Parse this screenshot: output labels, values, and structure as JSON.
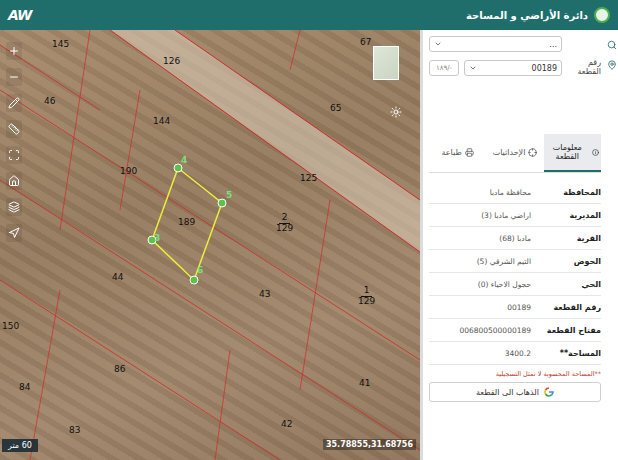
{
  "header": {
    "logo": "AW",
    "title": "دائرة الأراضي و المساحة"
  },
  "map": {
    "parcels": [
      {
        "label": "145"
      },
      {
        "label": "126"
      },
      {
        "label": "67"
      },
      {
        "label": "46"
      },
      {
        "label": "144"
      },
      {
        "label": "65"
      },
      {
        "label": "190"
      },
      {
        "label": "125"
      },
      {
        "label": "44"
      },
      {
        "label": "43"
      },
      {
        "label": "150"
      },
      {
        "label": "86"
      },
      {
        "label": "84"
      },
      {
        "label": "41"
      },
      {
        "label": "83"
      },
      {
        "label": "42"
      }
    ],
    "fractions": [
      {
        "top": "2",
        "bottom": "129"
      },
      {
        "top": "1",
        "bottom": "129"
      }
    ],
    "selected_parcel": {
      "label": "189",
      "vertices": [
        "4",
        "5",
        "6",
        "3"
      ]
    },
    "coordinates": "35.78855,31.68756",
    "scale": "60 متر"
  },
  "panel": {
    "top_field": {
      "value": "..."
    },
    "parcel_field": {
      "label": "رقم القطعة",
      "value": "00189",
      "suffix": "-/١٨٩"
    },
    "tabs": [
      {
        "label": "معلومات القطعة",
        "selected": true
      },
      {
        "label": "الإحداثيات",
        "selected": false
      },
      {
        "label": "طباعة",
        "selected": false
      }
    ],
    "info": [
      {
        "label": "المحافظة",
        "value": "محافظة مادبا"
      },
      {
        "label": "المديرية",
        "value": "اراضي مادبا (3)"
      },
      {
        "label": "القرية",
        "value": "مادبا (68)"
      },
      {
        "label": "الحوض",
        "value": "التيم الشرقي (5)"
      },
      {
        "label": "الحي",
        "value": "حجول الاحياء (0)"
      },
      {
        "label": "رقم القطعة",
        "value": "00189"
      },
      {
        "label": "مفتاح القطعة",
        "value": "006800500000189"
      },
      {
        "label": "المساحة**",
        "value": "3400.2"
      }
    ],
    "note": "**المساحة المحسوبة لا تمثل التسجيلية",
    "goto_button": "الذهاب الى القطعة"
  }
}
